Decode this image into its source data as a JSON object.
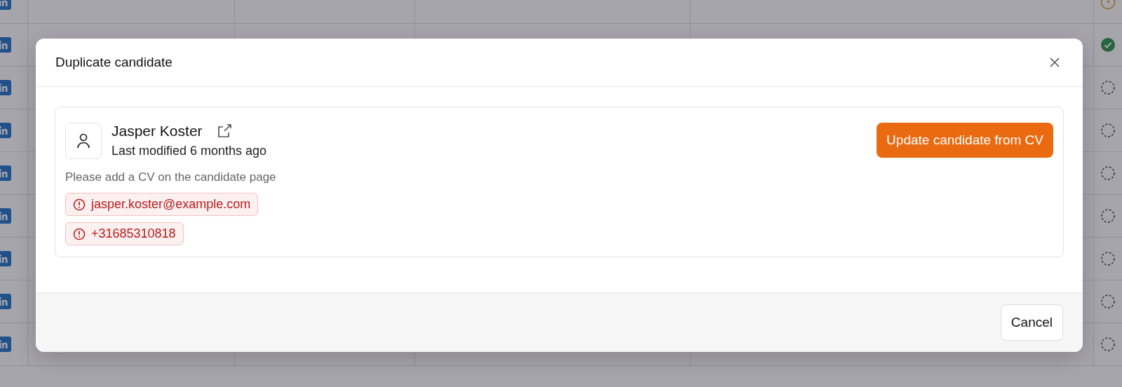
{
  "background_table": {
    "rows": [
      {
        "kind": "pending"
      },
      {
        "kind": "done"
      },
      {
        "kind": "todo"
      },
      {
        "kind": "todo"
      },
      {
        "kind": "todo"
      },
      {
        "kind": "todo"
      },
      {
        "kind": "todo"
      },
      {
        "kind": "todo"
      },
      {
        "kind": "todo"
      }
    ]
  },
  "dialog": {
    "title": "Duplicate candidate",
    "candidate": {
      "name": "Jasper Koster",
      "modified": "Last modified 6 months ago",
      "note": "Please add a CV on the candidate page",
      "conflicts": [
        "jasper.koster@example.com",
        "+31685310818"
      ]
    },
    "primary_button": "Update candidate from CV",
    "buttons": [
      "Cancel"
    ]
  }
}
